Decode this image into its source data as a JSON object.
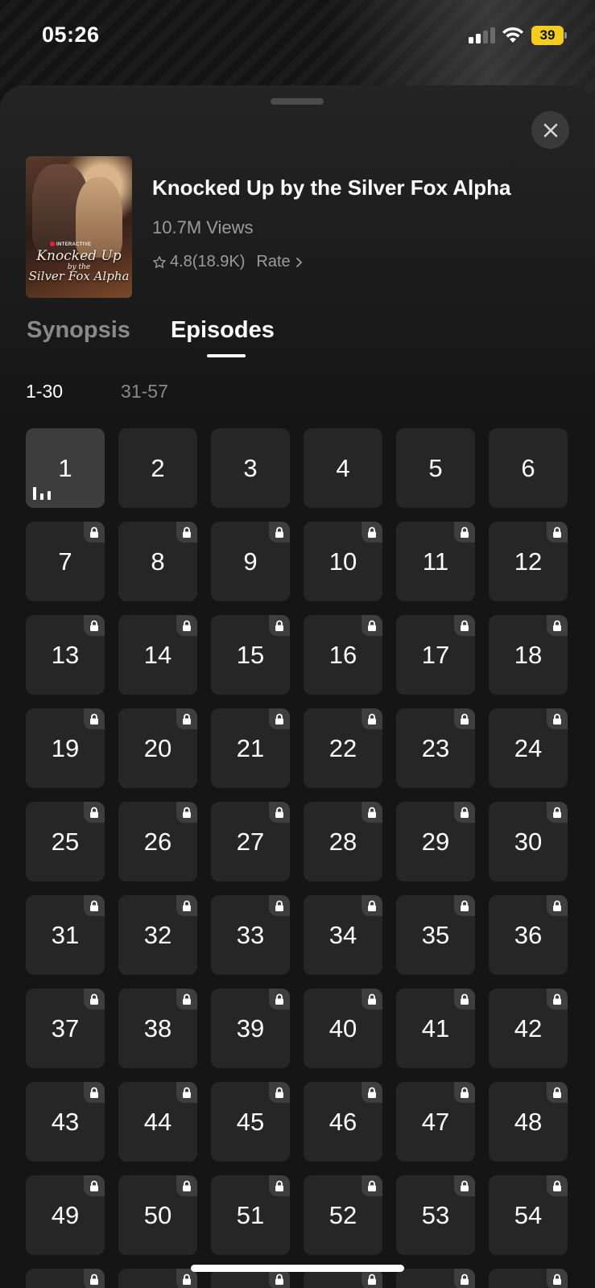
{
  "status_bar": {
    "time": "05:26",
    "battery_level": "39",
    "battery_color": "#f2cd1d"
  },
  "sheet": {
    "close_icon": "close-icon"
  },
  "show": {
    "cover_badge": "INTERACTIVE",
    "cover_title_line1": "Knocked Up",
    "cover_title_line2": "by the",
    "cover_title_line3": "Silver Fox Alpha",
    "title": "Knocked Up by the Silver Fox Alpha",
    "views": "10.7M Views",
    "rating": "4.8(18.9K)",
    "rate_label": "Rate"
  },
  "tabs": [
    {
      "label": "Synopsis",
      "active": false
    },
    {
      "label": "Episodes",
      "active": true
    }
  ],
  "ranges": [
    {
      "label": "1-30",
      "active": true
    },
    {
      "label": "31-57",
      "active": false
    }
  ],
  "episodes": {
    "current": 1,
    "unlocked": [
      1,
      2,
      3,
      4,
      5,
      6
    ],
    "visible_count": 60
  },
  "colors": {
    "sheet_bg": "#151515",
    "cell_bg": "#262626",
    "current_cell_bg": "#3d3d3d",
    "muted_text": "#9b9b9b"
  }
}
